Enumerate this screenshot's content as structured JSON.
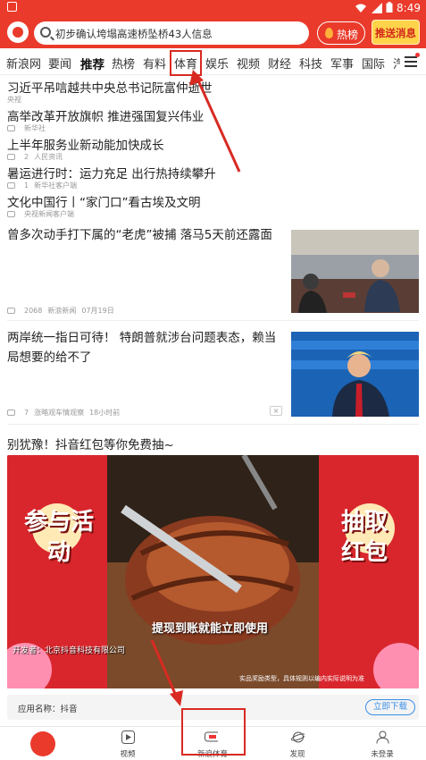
{
  "status_bar": {
    "time": "8:49"
  },
  "search": {
    "placeholder": "初步确认垮塌高速桥坠桥43人信息"
  },
  "header": {
    "hot_label": "热榜",
    "push_label": "推送消息"
  },
  "tabs": [
    {
      "label": "新浪网"
    },
    {
      "label": "要闻"
    },
    {
      "label": "推荐"
    },
    {
      "label": "热榜"
    },
    {
      "label": "有料"
    },
    {
      "label": "体育"
    },
    {
      "label": "娱乐"
    },
    {
      "label": "视频"
    },
    {
      "label": "财经"
    },
    {
      "label": "科技"
    },
    {
      "label": "军事"
    },
    {
      "label": "国际"
    },
    {
      "label": "汽"
    }
  ],
  "top_news": [
    {
      "title": "习近平吊唁越共中央总书记阮富仲逝世",
      "source": "央视"
    },
    {
      "title": "高举改革开放旗帜 推进强国复兴伟业",
      "source": "新华社"
    },
    {
      "title": "上半年服务业新动能加快成长",
      "comments": "2",
      "source": "人民资讯"
    },
    {
      "title": "暑运进行时：运力充足 出行热持续攀升",
      "comments": "1",
      "source": "新华社客户端"
    },
    {
      "title": "文化中国行丨“家门口”看古埃及文明",
      "source": "央视新闻客户端"
    }
  ],
  "stories": [
    {
      "title": "曾多次动手打下属的“老虎”被捕 落马5天前还露面",
      "comments": "2068",
      "source": "新浪新闻",
      "date": "07月19日"
    },
    {
      "title": "两岸统一指日可待！ 特朗普就涉台问题表态，赖当局想要的给不了",
      "comments": "7",
      "source": "涨略观车情观察",
      "date": "18小时前",
      "close": "×"
    }
  ],
  "ad": {
    "title": "别犹豫！抖音红包等你免费抽~",
    "left_banner": "参与活动",
    "right_banner": "抽取红包",
    "caption": "提现到账就能立即使用",
    "developer": "开发者：北京抖音科技有限公司",
    "footer_note": "实品奖励类型，具体规则以编内实际说明为准",
    "app_name": "应用名称：抖音",
    "download_label": "立即下载"
  },
  "bottom_nav": [
    {
      "label": "",
      "icon": "sina-home-icon"
    },
    {
      "label": "视频",
      "icon": "video-play-icon"
    },
    {
      "label": "新浪体育",
      "icon": "sina-sports-icon"
    },
    {
      "label": "发现",
      "icon": "planet-icon"
    },
    {
      "label": "未登录",
      "icon": "user-icon"
    }
  ],
  "colors": {
    "brand_red": "#ea3a2b",
    "highlight_red": "#d82a22",
    "link_blue": "#3a8ee6"
  }
}
